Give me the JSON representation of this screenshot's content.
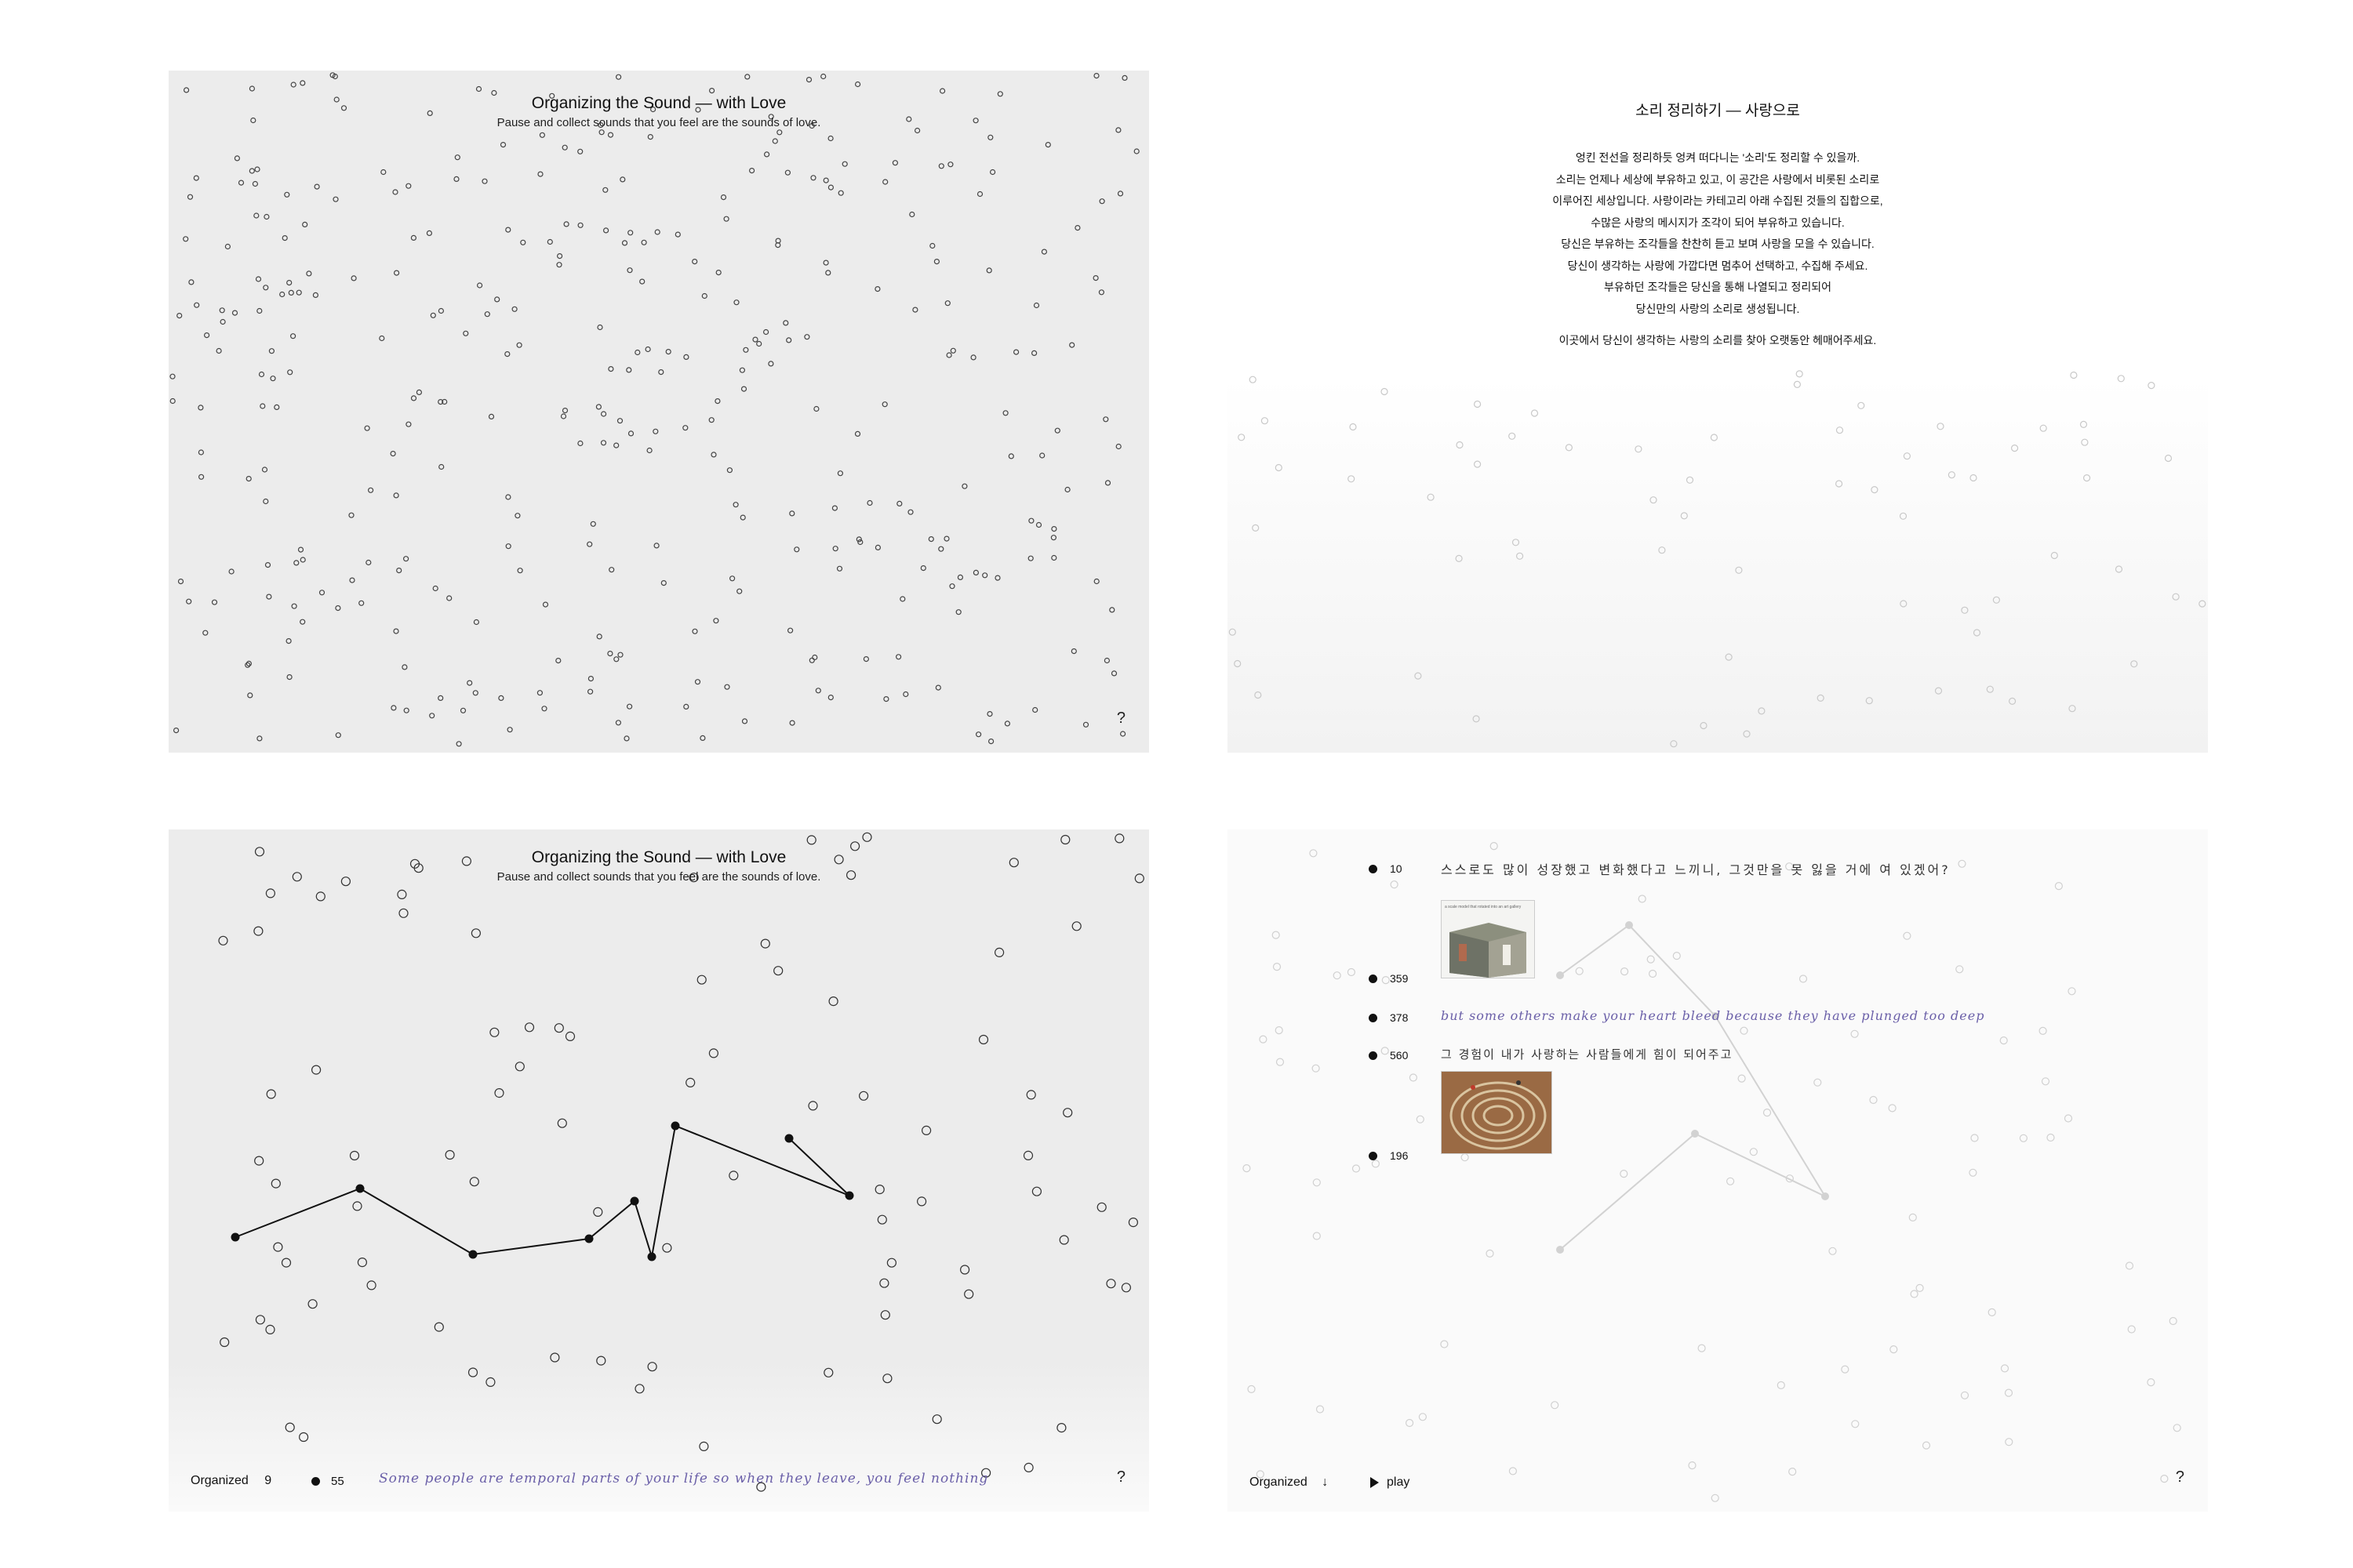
{
  "panel1": {
    "title": "Organizing the Sound — with Love",
    "subtitle": "Pause and collect sounds that you feel are the sounds of love.",
    "help": "?"
  },
  "panel2": {
    "title": "소리 정리하기 — 사랑으로",
    "lines": [
      "엉킨 전선을 정리하듯 엉켜 떠다니는 '소리'도 정리할 수 있을까.",
      "소리는 언제나 세상에 부유하고 있고, 이 공간은 사랑에서 비롯된 소리로",
      "이루어진 세상입니다. 사랑이라는 카테고리 아래 수집된 것들의 집합으로,",
      "수많은 사랑의 메시지가 조각이 되어 부유하고 있습니다.",
      "당신은 부유하는 조각들을 찬찬히 듣고 보며 사랑을 모을 수 있습니다.",
      "당신이 생각하는 사랑에 가깝다면 멈추어 선택하고, 수집해 주세요.",
      "부유하던 조각들은 당신을 통해 나열되고 정리되어",
      "당신만의 사랑의 소리로 생성됩니다."
    ],
    "footer": "이곳에서 당신이 생각하는 사랑의 소리를 찾아 오랫동안 헤매어주세요."
  },
  "panel3": {
    "title": "Organizing the Sound — with Love",
    "subtitle": "Pause and collect sounds that you feel are the sounds of love.",
    "organized_label": "Organized",
    "organized_count": "9",
    "current_id": "55",
    "current_text": "Some people are temporal parts of your life so when they leave, you feel nothing",
    "help": "?"
  },
  "panel4": {
    "fragments": [
      {
        "id": "10",
        "text": "스스로도 많이 성장했고 변화했다고 느끼니, 그것만을 못 잃을 거에 여 있겠어?"
      },
      {
        "id": "359",
        "text": ""
      },
      {
        "id": "378",
        "text": "but some others make your heart bleed because they have plunged too deep"
      },
      {
        "id": "560",
        "text": "그 경험이 내가 사랑하는 사람들에게 힘이 되어주고"
      },
      {
        "id": "196",
        "text": ""
      }
    ],
    "thumb_caption": "a scale model that rotated into an art gallery",
    "organized_label": "Organized",
    "organized_arrow": "↓",
    "play_label": "play",
    "help": "?"
  },
  "colors": {
    "handwriting": "#6a5fa8",
    "panel_gray": "#ececec",
    "line": "#111111"
  }
}
